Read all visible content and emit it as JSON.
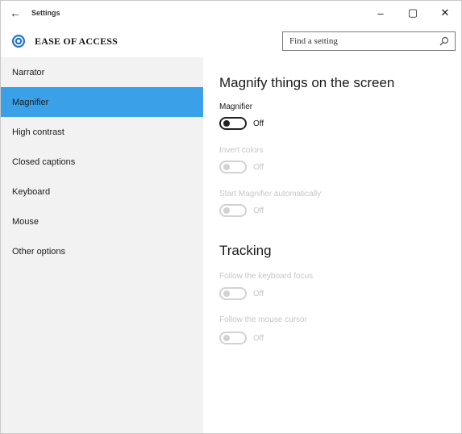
{
  "window": {
    "title": "Settings",
    "back_glyph": "←",
    "minimize_glyph": "–",
    "maximize_glyph": "▢",
    "close_glyph": "✕"
  },
  "header": {
    "title": "EASE OF ACCESS",
    "icon": "ease-of-access-gear-icon",
    "accent_color": "#1e73c8"
  },
  "search": {
    "placeholder": "Find a setting",
    "icon": "search-icon"
  },
  "sidebar": {
    "background": "#f2f2f2",
    "selected_color": "#3aa0e8",
    "items": [
      {
        "label": "Narrator",
        "selected": false
      },
      {
        "label": "Magnifier",
        "selected": true
      },
      {
        "label": "High contrast",
        "selected": false
      },
      {
        "label": "Closed captions",
        "selected": false
      },
      {
        "label": "Keyboard",
        "selected": false
      },
      {
        "label": "Mouse",
        "selected": false
      },
      {
        "label": "Other options",
        "selected": false
      }
    ]
  },
  "main": {
    "magnify_section": {
      "heading": "Magnify things on the screen",
      "magnifier": {
        "label": "Magnifier",
        "state": "Off",
        "enabled": true
      },
      "invert_colors": {
        "label": "Invert colors",
        "state": "Off",
        "enabled": false
      },
      "start_auto": {
        "label": "Start Magnifier automatically",
        "state": "Off",
        "enabled": false
      }
    },
    "tracking_section": {
      "heading": "Tracking",
      "keyboard_focus": {
        "label": "Follow the keyboard focus",
        "state": "Off",
        "enabled": false
      },
      "mouse_cursor": {
        "label": "Follow the mouse cursor",
        "state": "Off",
        "enabled": false
      }
    }
  }
}
